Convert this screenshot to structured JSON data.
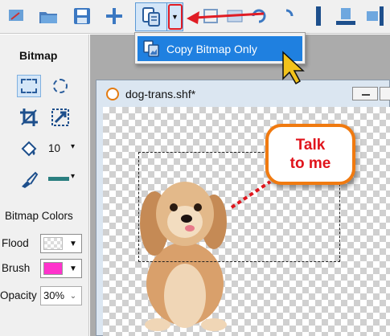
{
  "menu": {
    "copy_bitmap_only": "Copy Bitmap Only"
  },
  "panel": {
    "title": "Bitmap",
    "brush_size": "10",
    "colors_heading": "Bitmap Colors",
    "flood_label": "Flood",
    "brush_label": "Brush",
    "opacity_label": "Opacity",
    "opacity_value": "30%"
  },
  "document": {
    "title": "dog-trans.shf*"
  },
  "bubble": {
    "line1": "Talk",
    "line2": "to me"
  },
  "colors": {
    "accent": "#1f80e0",
    "brush": "#ff33cc",
    "callout_border": "#f07a10",
    "callout_text": "#e0141c",
    "annotation_red": "#e01c24"
  }
}
